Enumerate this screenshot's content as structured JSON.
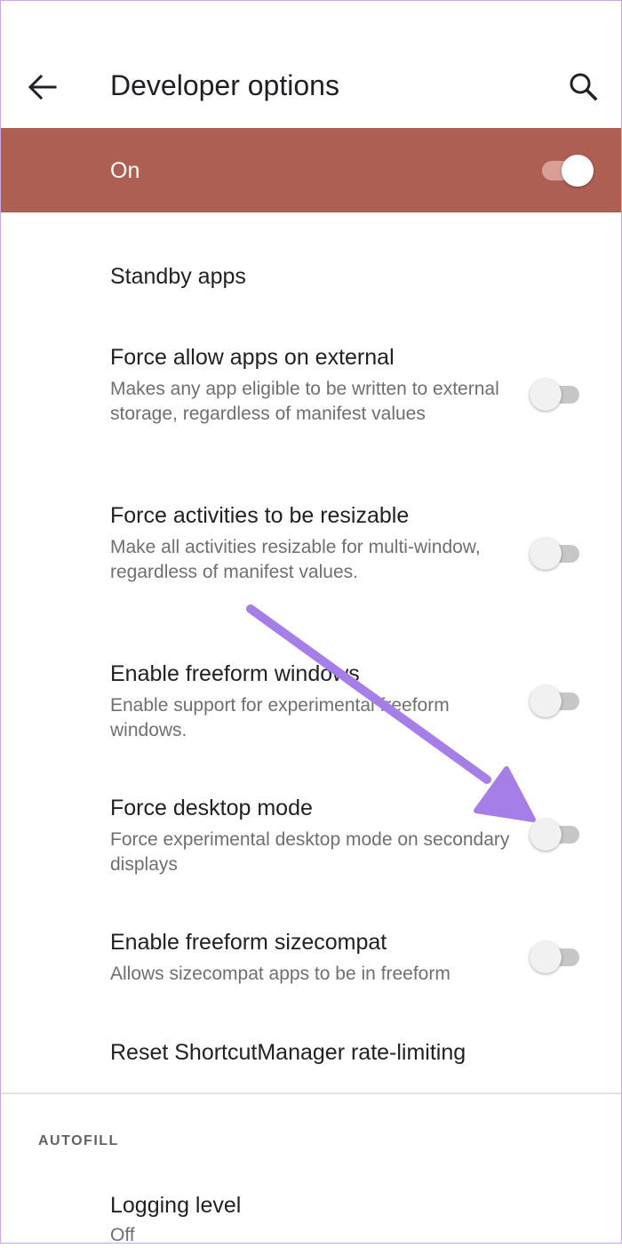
{
  "app_bar": {
    "back_icon": "arrow-left-icon",
    "title": "Developer options",
    "search_icon": "search-icon"
  },
  "master_switch": {
    "label": "On",
    "checked": true
  },
  "items": [
    {
      "title": "Standby apps",
      "summary": ""
    },
    {
      "title": "Force allow apps on external",
      "summary": "Makes any app eligible to be written to external storage, regardless of manifest values",
      "checked": false
    },
    {
      "title": "Force activities to be resizable",
      "summary": "Make all activities resizable for multi-window, regardless of manifest values.",
      "checked": false
    },
    {
      "title": "Enable freeform windows",
      "summary": "Enable support for experimental freeform windows.",
      "checked": false
    },
    {
      "title": "Force desktop mode",
      "summary": "Force experimental desktop mode on secondary displays",
      "checked": false
    },
    {
      "title": "Enable freeform sizecompat",
      "summary": "Allows sizecompat apps to be in freeform",
      "checked": false
    },
    {
      "title": "Reset ShortcutManager rate-limiting",
      "summary": ""
    }
  ],
  "autofill": {
    "header": "AUTOFILL",
    "logging_level": {
      "title": "Logging level",
      "value": "Off"
    }
  },
  "colors": {
    "master_bar": "#ae5f53",
    "annotation_arrow": "#a57ee8"
  }
}
